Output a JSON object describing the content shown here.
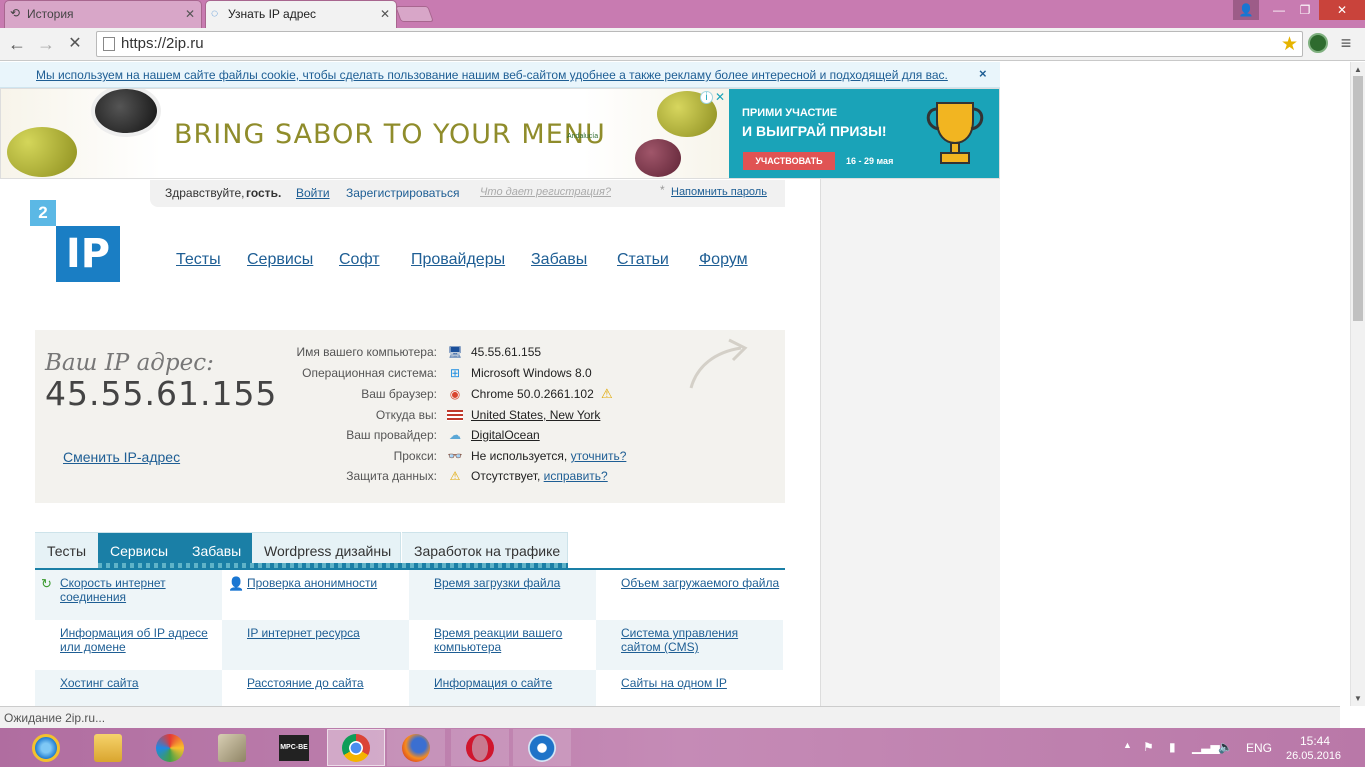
{
  "browser": {
    "tabs": [
      {
        "title": "История",
        "icon": "history-icon",
        "active": false
      },
      {
        "title": "Узнать IP адрес",
        "icon": "loading-icon",
        "active": true
      }
    ],
    "url": "https://2ip.ru",
    "status": "Ожидание 2ip.ru..."
  },
  "cookie": {
    "text": "Мы используем на нашем сайте файлы cookie, чтобы сделать пользование нашим веб-сайтом удобнее а также рекламу более интересной и подходящей для вас.",
    "close": "×"
  },
  "ad": {
    "slogan": "BRING SABOR TO YOUR MENU",
    "brand": "Andalucía",
    "promo_line1": "ПРИМИ УЧАСТИЕ",
    "promo_line2": "И ВЫИГРАЙ ПРИЗЫ!",
    "cta": "УЧАСТВОВАТЬ",
    "dates": "16 - 29 мая",
    "info": "i",
    "close": "✕"
  },
  "login": {
    "greeting": "Здравствуйте,",
    "guest": "гость.",
    "login": "Войти",
    "register": "Зарегистрироваться",
    "why": "Что дает регистрация?",
    "asterisk": "*",
    "remind": "Напомнить пароль"
  },
  "logo": {
    "small": "2",
    "main": "IP"
  },
  "nav": [
    "Тесты",
    "Сервисы",
    "Софт",
    "Провайдеры",
    "Забавы",
    "Статьи",
    "Форум"
  ],
  "ip": {
    "caption": "Ваш IP адрес:",
    "value": "45.55.61.155",
    "change": "Сменить IP-адрес",
    "rows": [
      {
        "label": "Имя вашего компьютера:",
        "icon": "computer-icon",
        "value": "45.55.61.155",
        "link": ""
      },
      {
        "label": "Операционная система:",
        "icon": "windows-icon",
        "value": "Microsoft Windows 8.0",
        "link": ""
      },
      {
        "label": "Ваш браузер:",
        "icon": "chrome-icon",
        "value": "Chrome 50.0.2661.102",
        "link": ""
      },
      {
        "label": "Откуда вы:",
        "icon": "us-flag-icon",
        "value": "",
        "link": "United States, New York"
      },
      {
        "label": "Ваш провайдер:",
        "icon": "cloud-icon",
        "value": "",
        "link": "DigitalOcean"
      },
      {
        "label": "Прокси:",
        "icon": "glasses-icon",
        "value": "Не используется,",
        "link": "уточнить?"
      },
      {
        "label": "Защита данных:",
        "icon": "warning-icon",
        "value": "Отсутствует,",
        "link": "исправить?"
      }
    ]
  },
  "service_tabs": [
    "Тесты",
    "Сервисы",
    "Забавы",
    "Wordpress дизайны",
    "Заработок на трафике"
  ],
  "services": [
    [
      "Скорость интернет соединения",
      "Проверка анонимности",
      "Время загрузки файла",
      "Объем загружаемого файла"
    ],
    [
      "Информация об IP адресе или домене",
      "IP интернет ресурса",
      "Время реакции вашего компьютера",
      "Система управления сайтом (CMS)"
    ],
    [
      "Хостинг сайта",
      "Расстояние до сайта",
      "Информация о сайте",
      "Сайты на одном IP"
    ]
  ],
  "taskbar": {
    "apps": [
      "ie-icon",
      "explorer-icon",
      "media-icon",
      "archive-icon",
      "mpc-be-icon",
      "chrome-icon",
      "firefox-icon",
      "opera-icon",
      "teamviewer-icon"
    ],
    "mpc_label": "MPC-BE",
    "lang": "ENG",
    "time": "15:44",
    "date": "26.05.2016"
  }
}
